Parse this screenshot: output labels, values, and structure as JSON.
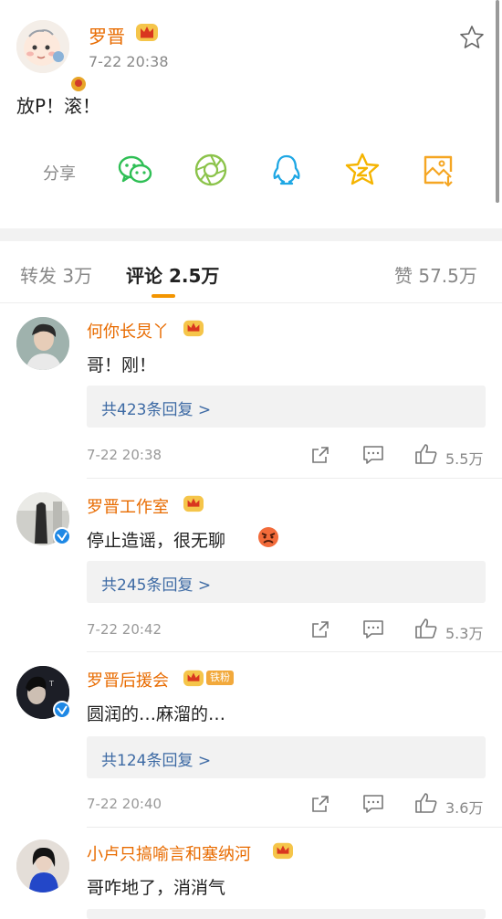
{
  "post": {
    "author": "罗晋",
    "time": "7-22 20:38",
    "text": "放P！滚！",
    "share_label": "分享",
    "share_targets": [
      "wechat-icon",
      "moments-icon",
      "qq-icon",
      "qzone-icon",
      "save-image-icon"
    ]
  },
  "tabs": {
    "repost": "转发 3万",
    "comment": "评论 2.5万",
    "like": "赞 57.5万"
  },
  "comments": [
    {
      "name": "何你长炅丫",
      "text": "哥！刚！",
      "replies": "共423条回复 >",
      "time": "7-22 20:38",
      "likes": "5.5万"
    },
    {
      "name": "罗晋工作室",
      "text": "停止造谣，很无聊",
      "replies": "共245条回复 >",
      "time": "7-22 20:42",
      "likes": "5.3万"
    },
    {
      "name": "罗晋后援会",
      "badge": "铁粉",
      "text": "圆润的…麻溜的…",
      "replies": "共124条回复 >",
      "time": "7-22 20:40",
      "likes": "3.6万"
    },
    {
      "name": "小卢只搞喻言和塞纳河",
      "text": "哥咋地了，消消气"
    }
  ],
  "colors": {
    "accent": "#e86b00",
    "link": "#3d6aa4",
    "indicator": "#f39500",
    "verified_blue": "#1e88e5"
  }
}
